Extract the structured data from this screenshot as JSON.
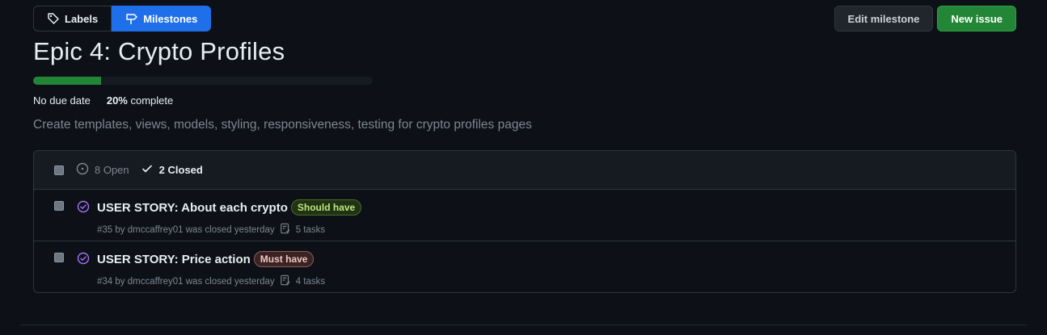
{
  "nav": {
    "labels": "Labels",
    "milestones": "Milestones"
  },
  "actions": {
    "edit": "Edit milestone",
    "new_issue": "New issue"
  },
  "milestone": {
    "title": "Epic 4: Crypto Profiles",
    "progress_percent": 20,
    "due": "No due date",
    "percent_text": "20%",
    "complete_text": "complete",
    "description": "Create templates, views, models, styling, responsiveness, testing for crypto profiles pages"
  },
  "list": {
    "open_count": "8 Open",
    "closed_count": "2 Closed",
    "issues": [
      {
        "title": "USER STORY: About each crypto",
        "label": "Should have",
        "label_color": "#c5e478",
        "meta": "#35 by dmccaffrey01 was closed yesterday",
        "tasks": "5 tasks"
      },
      {
        "title": "USER STORY: Price action",
        "label": "Must have",
        "label_color": "#f1c4c4",
        "meta": "#34 by dmccaffrey01 was closed yesterday",
        "tasks": "4 tasks"
      }
    ]
  },
  "colors": {
    "background": "#0d1117",
    "accent_blue": "#1f6feb",
    "success_green": "#238636",
    "closed_purple": "#a371f7"
  },
  "icons": [
    "tag-icon",
    "milestone-icon",
    "issue-open-icon",
    "check-icon",
    "issue-closed-icon",
    "tasklist-icon"
  ]
}
